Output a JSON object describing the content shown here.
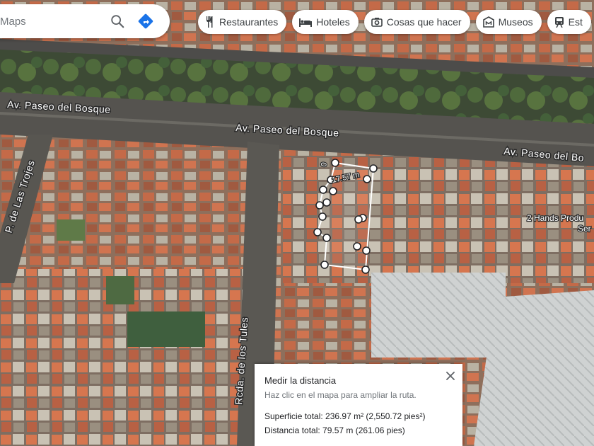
{
  "search": {
    "placeholder": "Maps"
  },
  "chips": [
    {
      "label": "Restaurantes",
      "icon": "fork-knife-icon"
    },
    {
      "label": "Hoteles",
      "icon": "bed-icon"
    },
    {
      "label": "Cosas que hacer",
      "icon": "camera-icon"
    },
    {
      "label": "Museos",
      "icon": "museum-icon"
    },
    {
      "label": "Est",
      "icon": "train-icon"
    }
  ],
  "map": {
    "streets": {
      "paseo_bosque_1": "Av. Paseo del Bosque",
      "paseo_bosque_2": "Av. Paseo del Bosque",
      "paseo_bosque_3": "Av. Paseo del Bo",
      "las_trojes": "P. de Las Trojes",
      "tules": "Rcda. de los Tules"
    },
    "poi": {
      "line1": "2 Hands Produ",
      "line2": "Ser"
    },
    "segment_label": "17.57 m",
    "mini_label": "0"
  },
  "measure": {
    "title": "Medir la distancia",
    "hint": "Haz clic en el mapa para ampliar la ruta.",
    "area": "Superficie total: 236.97 m² (2,550.72 pies²)",
    "distance": "Distancia total: 79.57 m (261.06 pies)"
  },
  "colors": {
    "accent_blue": "#1a73e8",
    "route_blue": "#4285f4"
  }
}
